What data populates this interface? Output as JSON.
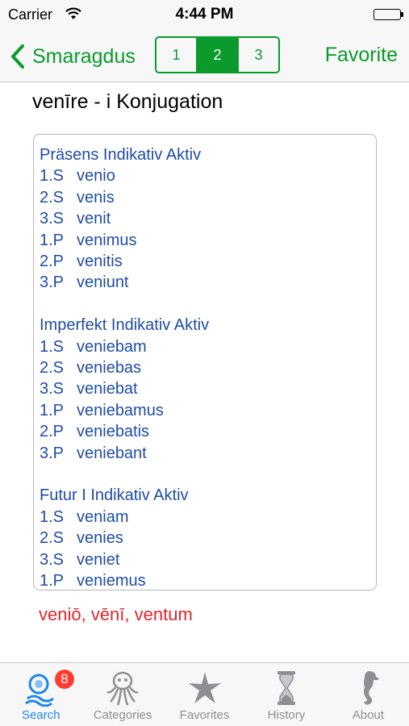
{
  "status_bar": {
    "carrier": "Carrier",
    "time": "4:44 PM"
  },
  "nav": {
    "back_label": "Smaragdus",
    "segments": [
      "1",
      "2",
      "3"
    ],
    "selected_segment": "2",
    "favorite_label": "Favorite"
  },
  "page": {
    "title": "venīre - i Konjugation",
    "principal_parts": "veniō, vēnī, ventum"
  },
  "conjugation": [
    {
      "heading": "Präsens Indikativ Aktiv",
      "rows": [
        {
          "person": "1.S",
          "form": "venio"
        },
        {
          "person": "2.S",
          "form": "venis"
        },
        {
          "person": "3.S",
          "form": "venit"
        },
        {
          "person": "1.P",
          "form": "venimus"
        },
        {
          "person": "2.P",
          "form": "venitis"
        },
        {
          "person": "3.P",
          "form": "veniunt"
        }
      ]
    },
    {
      "heading": "Imperfekt Indikativ Aktiv",
      "rows": [
        {
          "person": "1.S",
          "form": "veniebam"
        },
        {
          "person": "2.S",
          "form": "veniebas"
        },
        {
          "person": "3.S",
          "form": "veniebat"
        },
        {
          "person": "1.P",
          "form": "veniebamus"
        },
        {
          "person": "2.P",
          "form": "veniebatis"
        },
        {
          "person": "3.P",
          "form": "veniebant"
        }
      ]
    },
    {
      "heading": "Futur I Indikativ Aktiv",
      "rows": [
        {
          "person": "1.S",
          "form": "veniam"
        },
        {
          "person": "2.S",
          "form": "venies"
        },
        {
          "person": "3.S",
          "form": "veniet"
        },
        {
          "person": "1.P",
          "form": "veniemus"
        }
      ]
    }
  ],
  "tabbar": {
    "tabs": [
      {
        "label": "Search",
        "icon": "search-tab-icon",
        "active": true
      },
      {
        "label": "Categories",
        "icon": "octopus-icon",
        "active": false
      },
      {
        "label": "Favorites",
        "icon": "starfish-icon",
        "active": false
      },
      {
        "label": "History",
        "icon": "hourglass-icon",
        "active": false
      },
      {
        "label": "About",
        "icon": "seahorse-icon",
        "active": false
      }
    ],
    "search_badge": "8"
  },
  "colors": {
    "accent": "#0a9b2c",
    "conjugation_text": "#1f4ca5",
    "principal_parts": "#e2242c",
    "tab_active": "#1c87e6",
    "tab_inactive": "#8e8e93",
    "badge": "#ff3b30"
  }
}
